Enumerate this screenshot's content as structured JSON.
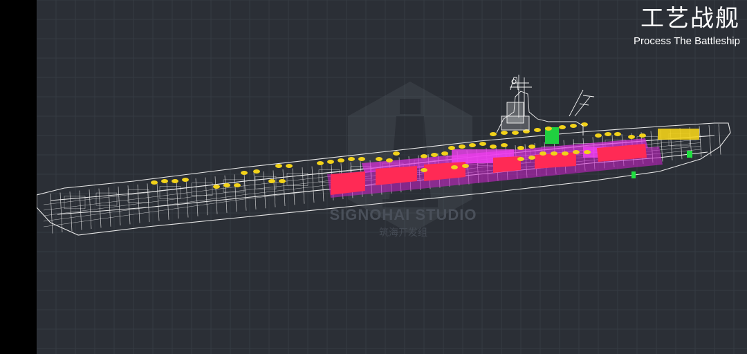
{
  "header": {
    "title_zh": "工艺战舰",
    "title_en": "Process The Battleship"
  },
  "watermark": {
    "studio_en": "SIGNOHAI STUDIO",
    "studio_zh": "筑海开发组"
  },
  "colors": {
    "background": "#2b2f36",
    "grid": "#363b43",
    "wire": "#e8e8e8",
    "magenta": "#e020e0",
    "red": "#ff2a55",
    "yellow": "#f2d21a",
    "green": "#20e040",
    "letterbox": "#000000"
  }
}
